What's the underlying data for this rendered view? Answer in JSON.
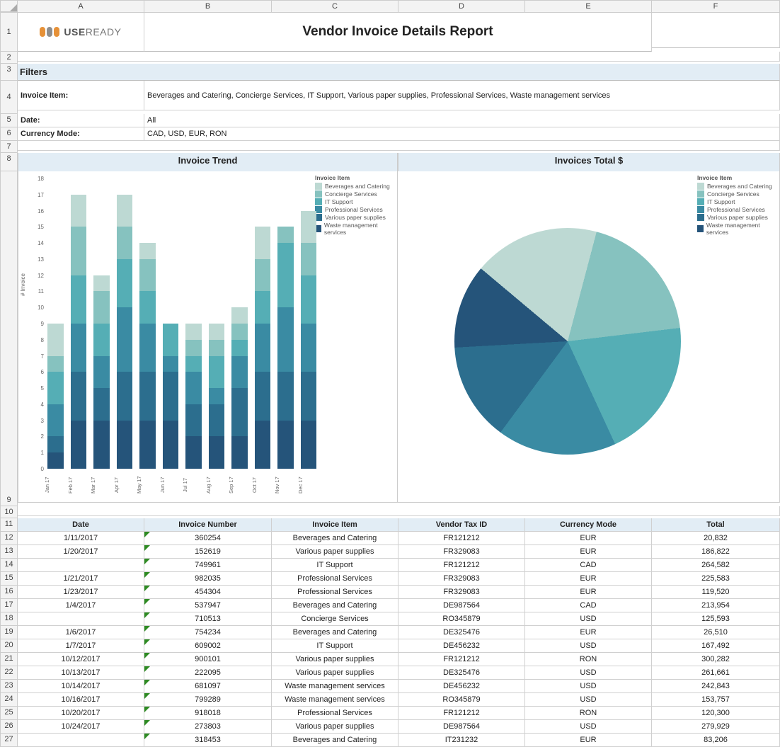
{
  "columns": [
    "A",
    "B",
    "C",
    "D",
    "E",
    "F"
  ],
  "title": "Vendor Invoice Details Report",
  "logo_text_1": "USE",
  "logo_text_2": "READY",
  "filters_header": "Filters",
  "filters": {
    "invoice_item_label": "Invoice Item:",
    "invoice_item_value": "Beverages and Catering, Concierge Services, IT Support, Various paper supplies, Professional Services, Waste management services",
    "date_label": "Date:",
    "date_value": "All",
    "currency_label": "Currency Mode:",
    "currency_value": "CAD, USD, EUR, RON"
  },
  "chart_headers": [
    "Invoice Trend",
    "Invoices Total $"
  ],
  "legend_title": "Invoice Item",
  "legend_items": [
    {
      "label": "Beverages and Catering",
      "color": "#bdd9d3"
    },
    {
      "label": "Concierge Services",
      "color": "#86c2bf"
    },
    {
      "label": "IT Support",
      "color": "#55aeb5"
    },
    {
      "label": "Professional Services",
      "color": "#3a8ba3"
    },
    {
      "label": "Various paper supplies",
      "color": "#2c6e8e"
    },
    {
      "label": "Waste management services",
      "color": "#25547a"
    }
  ],
  "y_label": "# Invoice",
  "chart_data": [
    {
      "type": "stacked-bar",
      "title": "Invoice Trend",
      "xlabel": "",
      "ylabel": "# Invoice",
      "ylim": [
        0,
        18
      ],
      "categories": [
        "Jan 17",
        "Feb 17",
        "Mar 17",
        "Apr 17",
        "May 17",
        "Jun 17",
        "Jul 17",
        "Aug 17",
        "Sep 17",
        "Oct 17",
        "Nov 17",
        "Dec 17"
      ],
      "series": [
        {
          "name": "Beverages and Catering",
          "values": [
            2,
            2,
            1,
            2,
            1,
            0,
            1,
            1,
            1,
            2,
            0,
            2
          ]
        },
        {
          "name": "Concierge Services",
          "values": [
            1,
            3,
            2,
            2,
            2,
            0,
            1,
            1,
            1,
            2,
            1,
            2
          ]
        },
        {
          "name": "IT Support",
          "values": [
            2,
            3,
            2,
            3,
            2,
            2,
            1,
            2,
            1,
            2,
            4,
            3
          ]
        },
        {
          "name": "Professional Services",
          "values": [
            2,
            3,
            2,
            4,
            3,
            1,
            2,
            1,
            2,
            3,
            4,
            3
          ]
        },
        {
          "name": "Various paper supplies",
          "values": [
            1,
            3,
            2,
            3,
            3,
            3,
            2,
            2,
            3,
            3,
            3,
            3
          ]
        },
        {
          "name": "Waste management services",
          "values": [
            1,
            3,
            3,
            3,
            3,
            3,
            2,
            2,
            2,
            3,
            3,
            3
          ]
        }
      ]
    },
    {
      "type": "pie",
      "title": "Invoices Total $",
      "series": [
        {
          "name": "Beverages and Catering",
          "value": 18,
          "color": "#bdd9d3"
        },
        {
          "name": "Concierge Services",
          "value": 19,
          "color": "#86c2bf"
        },
        {
          "name": "IT Support",
          "value": 20,
          "color": "#55aeb5"
        },
        {
          "name": "Professional Services",
          "value": 17,
          "color": "#3a8ba3"
        },
        {
          "name": "Various paper supplies",
          "value": 14,
          "color": "#2c6e8e"
        },
        {
          "name": "Waste management services",
          "value": 12,
          "color": "#25547a"
        }
      ]
    }
  ],
  "table_headers": [
    "Date",
    "Invoice Number",
    "Invoice Item",
    "Vendor Tax ID",
    "Currency Mode",
    "Total"
  ],
  "table_rows": [
    {
      "r": "12",
      "date": "1/11/2017",
      "num": "360254",
      "item": "Beverages and Catering",
      "tax": "FR121212",
      "cur": "EUR",
      "total": "20,832"
    },
    {
      "r": "13",
      "date": "1/20/2017",
      "num": "152619",
      "item": "Various paper supplies",
      "tax": "FR329083",
      "cur": "EUR",
      "total": "186,822"
    },
    {
      "r": "14",
      "date": "",
      "num": "749961",
      "item": "IT Support",
      "tax": "FR121212",
      "cur": "CAD",
      "total": "264,582"
    },
    {
      "r": "15",
      "date": "1/21/2017",
      "num": "982035",
      "item": "Professional Services",
      "tax": "FR329083",
      "cur": "EUR",
      "total": "225,583"
    },
    {
      "r": "16",
      "date": "1/23/2017",
      "num": "454304",
      "item": "Professional Services",
      "tax": "FR329083",
      "cur": "EUR",
      "total": "119,520"
    },
    {
      "r": "17",
      "date": "1/4/2017",
      "num": "537947",
      "item": "Beverages and Catering",
      "tax": "DE987564",
      "cur": "CAD",
      "total": "213,954"
    },
    {
      "r": "18",
      "date": "",
      "num": "710513",
      "item": "Concierge Services",
      "tax": "RO345879",
      "cur": "USD",
      "total": "125,593"
    },
    {
      "r": "19",
      "date": "1/6/2017",
      "num": "754234",
      "item": "Beverages and Catering",
      "tax": "DE325476",
      "cur": "EUR",
      "total": "26,510"
    },
    {
      "r": "20",
      "date": "1/7/2017",
      "num": "609002",
      "item": "IT Support",
      "tax": "DE456232",
      "cur": "USD",
      "total": "167,492"
    },
    {
      "r": "21",
      "date": "10/12/2017",
      "num": "900101",
      "item": "Various paper supplies",
      "tax": "FR121212",
      "cur": "RON",
      "total": "300,282"
    },
    {
      "r": "22",
      "date": "10/13/2017",
      "num": "222095",
      "item": "Various paper supplies",
      "tax": "DE325476",
      "cur": "USD",
      "total": "261,661"
    },
    {
      "r": "23",
      "date": "10/14/2017",
      "num": "681097",
      "item": "Waste management services",
      "tax": "DE456232",
      "cur": "USD",
      "total": "242,843"
    },
    {
      "r": "24",
      "date": "10/16/2017",
      "num": "799289",
      "item": "Waste management services",
      "tax": "RO345879",
      "cur": "USD",
      "total": "153,757"
    },
    {
      "r": "25",
      "date": "10/20/2017",
      "num": "918018",
      "item": "Professional Services",
      "tax": "FR121212",
      "cur": "RON",
      "total": "120,300"
    },
    {
      "r": "26",
      "date": "10/24/2017",
      "num": "273803",
      "item": "Various paper supplies",
      "tax": "DE987564",
      "cur": "USD",
      "total": "279,929"
    },
    {
      "r": "27",
      "date": "",
      "num": "318453",
      "item": "Beverages and Catering",
      "tax": "IT231232",
      "cur": "EUR",
      "total": "83,206"
    }
  ],
  "row_heads_top": [
    "1",
    "2",
    "3",
    "4",
    "5",
    "6",
    "7",
    "8",
    "9",
    "10",
    "11"
  ]
}
